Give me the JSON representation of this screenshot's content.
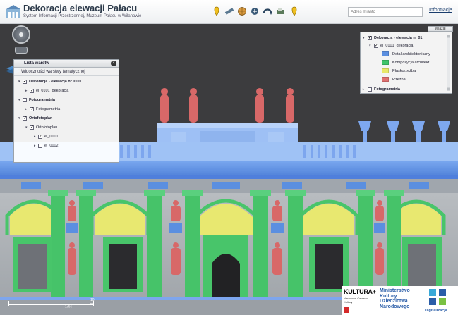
{
  "header": {
    "title": "Dekoracja elewacji Pałacu",
    "subtitle": "System Informacji Przestrzennej, Muzeum Pałacu w Wilanowie",
    "search_placeholder": "Adres miasto",
    "info_link": "Informacje"
  },
  "toolbar": {
    "tools": [
      "marker-icon",
      "measure-icon",
      "globe-icon",
      "move-icon",
      "rotate-icon",
      "print-icon",
      "pin-icon"
    ]
  },
  "layer_panel": {
    "title": "Lista warstw",
    "subtitle": "Widoczności warstwy tematycznej",
    "items": [
      {
        "label": "Dekoracja - elewacja nr 0101",
        "bold": true,
        "checked": true,
        "expanded": true,
        "level": 0
      },
      {
        "label": "el_0101_dekoracja",
        "bold": false,
        "checked": true,
        "expanded": false,
        "level": 1
      },
      {
        "label": "Fotogrametria",
        "bold": true,
        "checked": false,
        "expanded": true,
        "level": 0
      },
      {
        "label": "Fotogrametria",
        "bold": false,
        "checked": true,
        "expanded": false,
        "level": 1
      },
      {
        "label": "Ortofotoplan",
        "bold": true,
        "checked": true,
        "expanded": true,
        "level": 0
      },
      {
        "label": "Ortofotoplan",
        "bold": false,
        "checked": true,
        "expanded": true,
        "level": 1
      },
      {
        "label": "el_0101",
        "bold": false,
        "checked": true,
        "expanded": false,
        "level": 2
      },
      {
        "label": "el_0102",
        "bold": false,
        "checked": false,
        "expanded": false,
        "level": 2
      }
    ]
  },
  "legend_panel": {
    "show_button": "Wiązaj",
    "group_label": "Dekoracja - elewacja nr 01",
    "sub_label": "el_0101_dekoracja",
    "entries": [
      {
        "label": "Detal architektoniczny",
        "color": "#5b8fe0"
      },
      {
        "label": "Kompozycja architekt",
        "color": "#3ec46a"
      },
      {
        "label": "Płaskorzeźba",
        "color": "#e8e86a"
      },
      {
        "label": "Rzeźba",
        "color": "#e07070"
      }
    ],
    "footer_label": "Fotogrametria"
  },
  "scale": {
    "label": "10 m",
    "sub": "1:44"
  },
  "logos": {
    "kultura_text": "KULTURA+",
    "kultura_sub": "Narodowe Centrum Kultury",
    "ministry_text": "Ministerstwo Kultury i Dziedzictwa Narodowego",
    "digit_text": "Digitalizacja"
  },
  "colors": {
    "detail": "#5b8fe0",
    "composition": "#3ec46a",
    "relief": "#e8e86a",
    "sculpture": "#e07070",
    "background": "#3a3a3c"
  }
}
